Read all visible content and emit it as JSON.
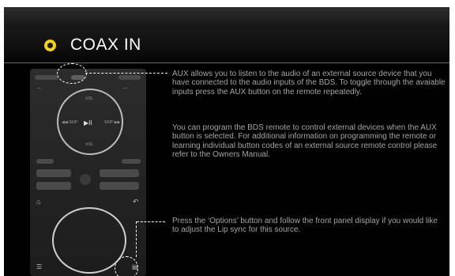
{
  "header": {
    "title": "COAX IN",
    "radio_color": "#f2d21a"
  },
  "remote": {
    "dpad_labels": [
      "VOL",
      "◀◀ SKIP",
      "▶II",
      "SKIP ▶▶",
      "VOL"
    ],
    "icons": [
      "home-icon",
      "back-icon",
      "options-icon",
      "menu-icon"
    ]
  },
  "description": {
    "para1": "AUX allows you to listen to the audio of an external source device that you have connected to the audio inputs of the BDS. To toggle through the avaiable inputs press the  AUX button on the remote repeatedly.",
    "para2": "You can program the BDS remote to control external devices when the AUX button is selected. For additional information on programming the remote or learning individual button codes of an external source remote control please refer to the Owners Manual.",
    "para3": "Press the ‘Options’ button and follow the front panel display if you would like to adjust the Lip sync for this source."
  }
}
